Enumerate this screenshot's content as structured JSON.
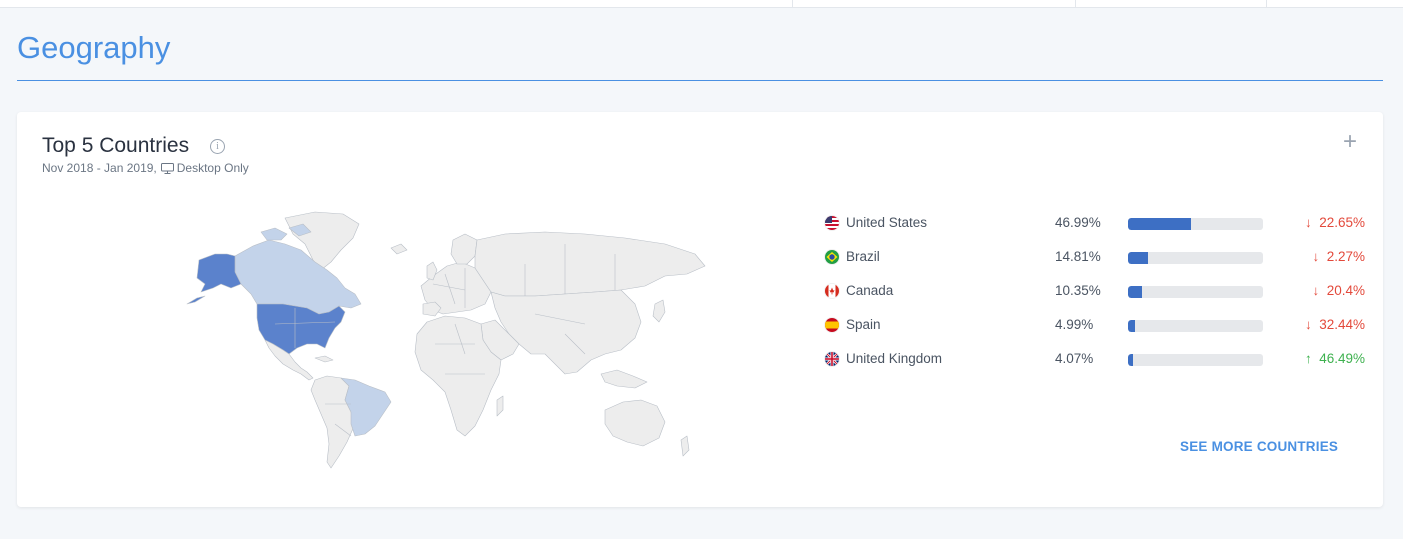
{
  "section": {
    "title": "Geography"
  },
  "card": {
    "title": "Top 5 Countries",
    "info_icon": "info-icon",
    "date_range": "Nov 2018 - Jan 2019,",
    "device_icon": "desktop-icon",
    "device_filter": "Desktop Only",
    "expand_icon": "plus-icon",
    "see_more_label": "SEE MORE COUNTRIES"
  },
  "colors": {
    "accent": "#4a90e2",
    "bar_fill": "#3d6fc4",
    "bar_track": "#e6e8eb",
    "negative": "#e3493b",
    "positive": "#3eb14f",
    "map_top": "#5b82cc",
    "map_secondary": "#c3d3ea",
    "map_default": "#ededed"
  },
  "countries": [
    {
      "name": "United States",
      "share": "46.99%",
      "share_value": 46.99,
      "change": "22.65%",
      "direction": "down",
      "arrow": "↓",
      "flag": "us-flag-icon"
    },
    {
      "name": "Brazil",
      "share": "14.81%",
      "share_value": 14.81,
      "change": "2.27%",
      "direction": "down",
      "arrow": "↓",
      "flag": "brazil-flag-icon"
    },
    {
      "name": "Canada",
      "share": "10.35%",
      "share_value": 10.35,
      "change": "20.4%",
      "direction": "down",
      "arrow": "↓",
      "flag": "canada-flag-icon"
    },
    {
      "name": "Spain",
      "share": "4.99%",
      "share_value": 4.99,
      "change": "32.44%",
      "direction": "down",
      "arrow": "↓",
      "flag": "spain-flag-icon"
    },
    {
      "name": "United Kingdom",
      "share": "4.07%",
      "share_value": 4.07,
      "change": "46.49%",
      "direction": "up",
      "arrow": "↑",
      "flag": "uk-flag-icon"
    }
  ]
}
